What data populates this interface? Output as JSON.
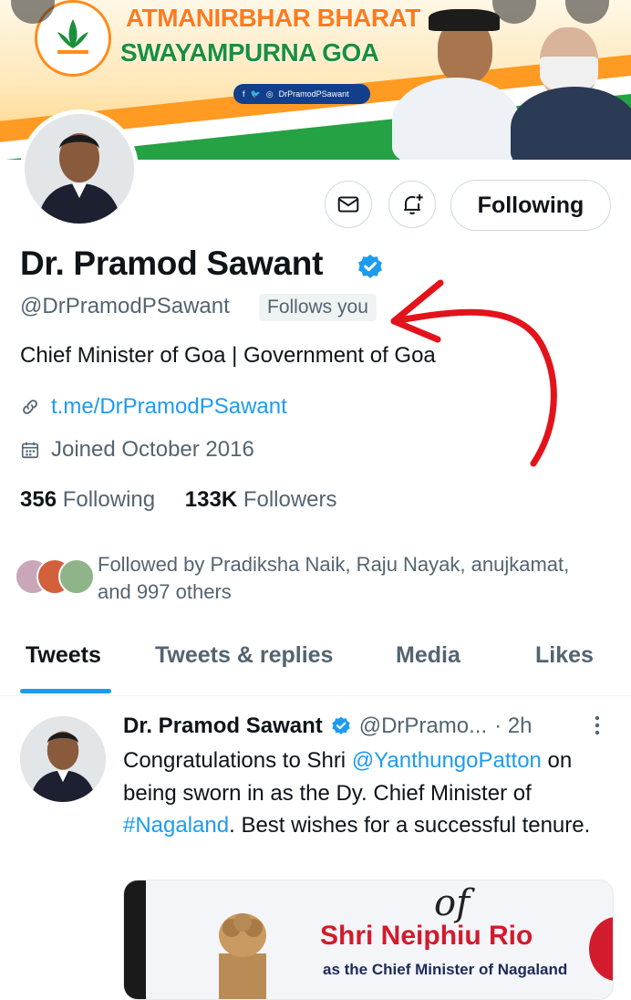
{
  "banner": {
    "line1": "ATMANIRBHAR BHARAT",
    "line2": "SWAYAMPURNA GOA",
    "social_handle": "DrPramodPSawant"
  },
  "profile": {
    "name": "Dr. Pramod Sawant",
    "handle": "@DrPramodPSawant",
    "follows_you": "Follows you",
    "bio": "Chief Minister of Goa | Government of Goa",
    "link": "t.me/DrPramodPSawant",
    "joined": "Joined October 2016",
    "following_count": "356",
    "following_label": "Following",
    "followers_count": "133K",
    "followers_label": "Followers",
    "followed_by": "Followed by Pradiksha Naik, Raju Nayak, anujkamat, and 997 others"
  },
  "actions": {
    "following_button": "Following"
  },
  "tabs": [
    "Tweets",
    "Tweets & replies",
    "Media",
    "Likes"
  ],
  "tweet": {
    "name": "Dr. Pramod Sawant",
    "handle": "@DrPramo...",
    "time": "· 2h",
    "text_1": "Congratulations to Shri ",
    "mention": "@YanthungoPatton",
    "text_2": " on being sworn in as the  Dy. Chief Minister of ",
    "hashtag": "#Nagaland",
    "text_3": ". Best wishes for a successful tenure.",
    "media_top": "of",
    "media_line1": "Shri Neiphiu Rio",
    "media_line2": "as the Chief Minister of Nagaland"
  },
  "colors": {
    "accent": "#1d9bf0",
    "annotation": "#e3131b"
  }
}
